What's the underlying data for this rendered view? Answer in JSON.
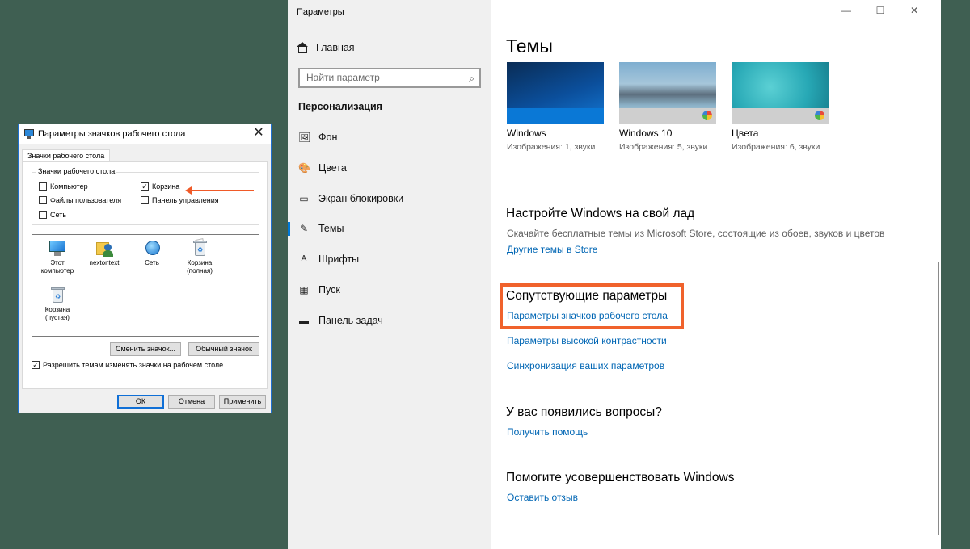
{
  "dialog": {
    "title": "Параметры значков рабочего стола",
    "tab": "Значки рабочего стола",
    "group_legend": "Значки рабочего стола",
    "checkboxes": [
      {
        "label": "Компьютер",
        "checked": false
      },
      {
        "label": "Корзина",
        "checked": true
      },
      {
        "label": "Файлы пользователя",
        "checked": false
      },
      {
        "label": "Панель управления",
        "checked": false
      },
      {
        "label": "Сеть",
        "checked": false
      }
    ],
    "icons": [
      {
        "label": "Этот\nкомпьютер",
        "icon": "computer-icon"
      },
      {
        "label": "nextontext",
        "icon": "user-folder-icon"
      },
      {
        "label": "Сеть",
        "icon": "network-icon"
      },
      {
        "label": "Корзина\n(полная)",
        "icon": "recycle-bin-full-icon"
      },
      {
        "label": "Корзина\n(пустая)",
        "icon": "recycle-bin-empty-icon"
      }
    ],
    "change_icon_button": "Сменить значок...",
    "default_icon_button": "Обычный значок",
    "allow_themes": {
      "label": "Разрешить темам изменять значки на рабочем столе",
      "checked": true
    },
    "ok_button": "ОК",
    "cancel_button": "Отмена",
    "apply_button": "Применить"
  },
  "settings": {
    "window_title": "Параметры",
    "window_controls": {
      "minimize": "—",
      "maximize": "☐",
      "close": "✕"
    },
    "home": "Главная",
    "search_placeholder": "Найти параметр",
    "section": "Персонализация",
    "nav": [
      {
        "label": "Фон",
        "icon": "image-icon",
        "active": false
      },
      {
        "label": "Цвета",
        "icon": "palette-icon",
        "active": false
      },
      {
        "label": "Экран блокировки",
        "icon": "lock-screen-icon",
        "active": false
      },
      {
        "label": "Темы",
        "icon": "themes-icon",
        "active": true
      },
      {
        "label": "Шрифты",
        "icon": "fonts-icon",
        "active": false
      },
      {
        "label": "Пуск",
        "icon": "start-icon",
        "active": false
      },
      {
        "label": "Панель задач",
        "icon": "taskbar-icon",
        "active": false
      }
    ],
    "page_title": "Темы",
    "themes": [
      {
        "name": "Windows",
        "meta": "Изображения: 1, звуки"
      },
      {
        "name": "Windows 10",
        "meta": "Изображения: 5, звуки"
      },
      {
        "name": "Цвета",
        "meta": "Изображения: 6, звуки"
      }
    ],
    "customize": {
      "heading": "Настройте Windows на свой лад",
      "text": "Скачайте бесплатные темы из Microsoft Store, состоящие из обоев, звуков и цветов",
      "link": "Другие темы в Store"
    },
    "related": {
      "heading": "Сопутствующие параметры",
      "links": [
        "Параметры значков рабочего стола",
        "Параметры высокой контрастности",
        "Синхронизация ваших параметров"
      ]
    },
    "questions": {
      "heading": "У вас появились вопросы?",
      "link": "Получить помощь"
    },
    "improve": {
      "heading": "Помогите усовершенствовать Windows",
      "link": "Оставить отзыв"
    }
  },
  "colors": {
    "accent": "#0078d7",
    "link": "#0066b4",
    "highlight": "#f0622c",
    "desktop": "#3f5f52"
  }
}
